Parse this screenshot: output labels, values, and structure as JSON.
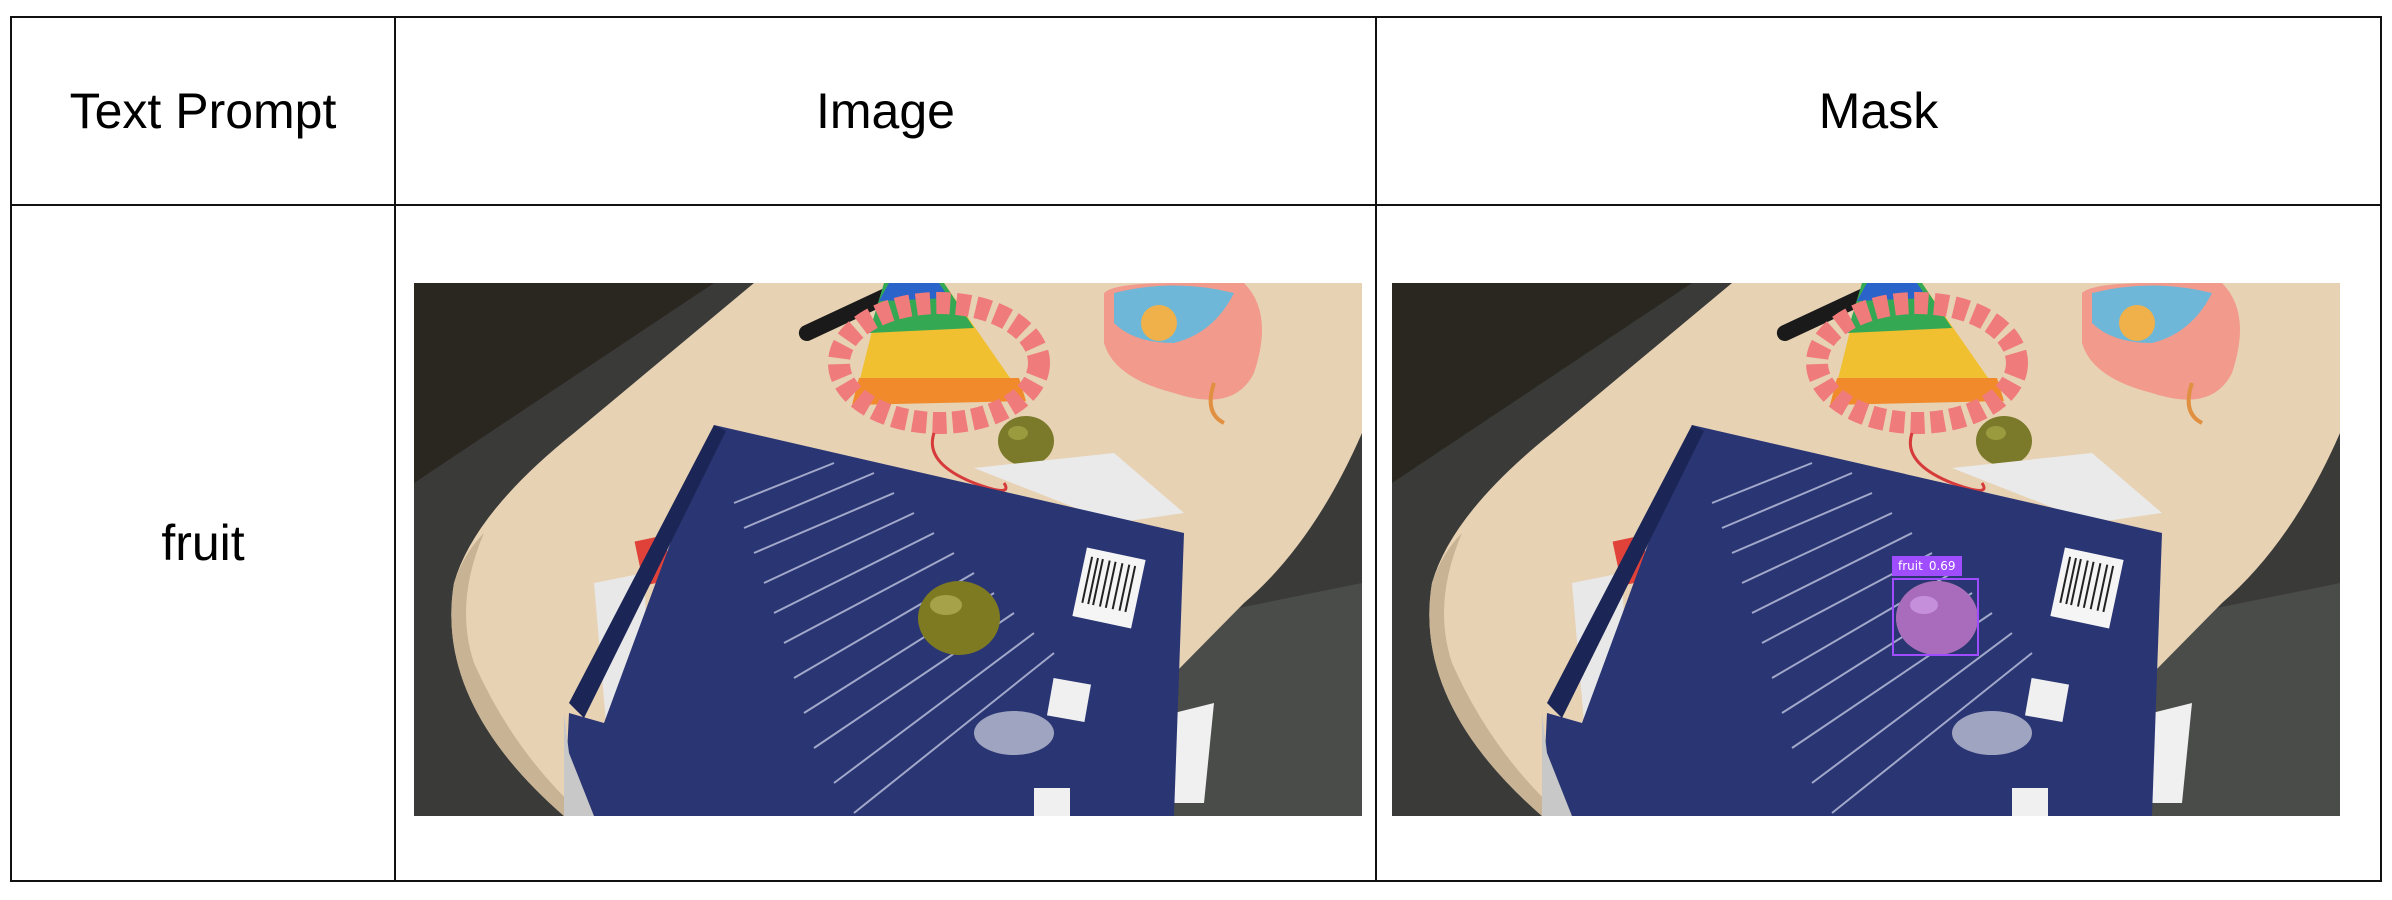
{
  "table": {
    "headers": [
      "Text Prompt",
      "Image",
      "Mask"
    ],
    "rows": [
      {
        "prompt": "fruit"
      }
    ]
  },
  "detection": {
    "label": "fruit",
    "score": "0.69",
    "color": "#a04cff"
  }
}
